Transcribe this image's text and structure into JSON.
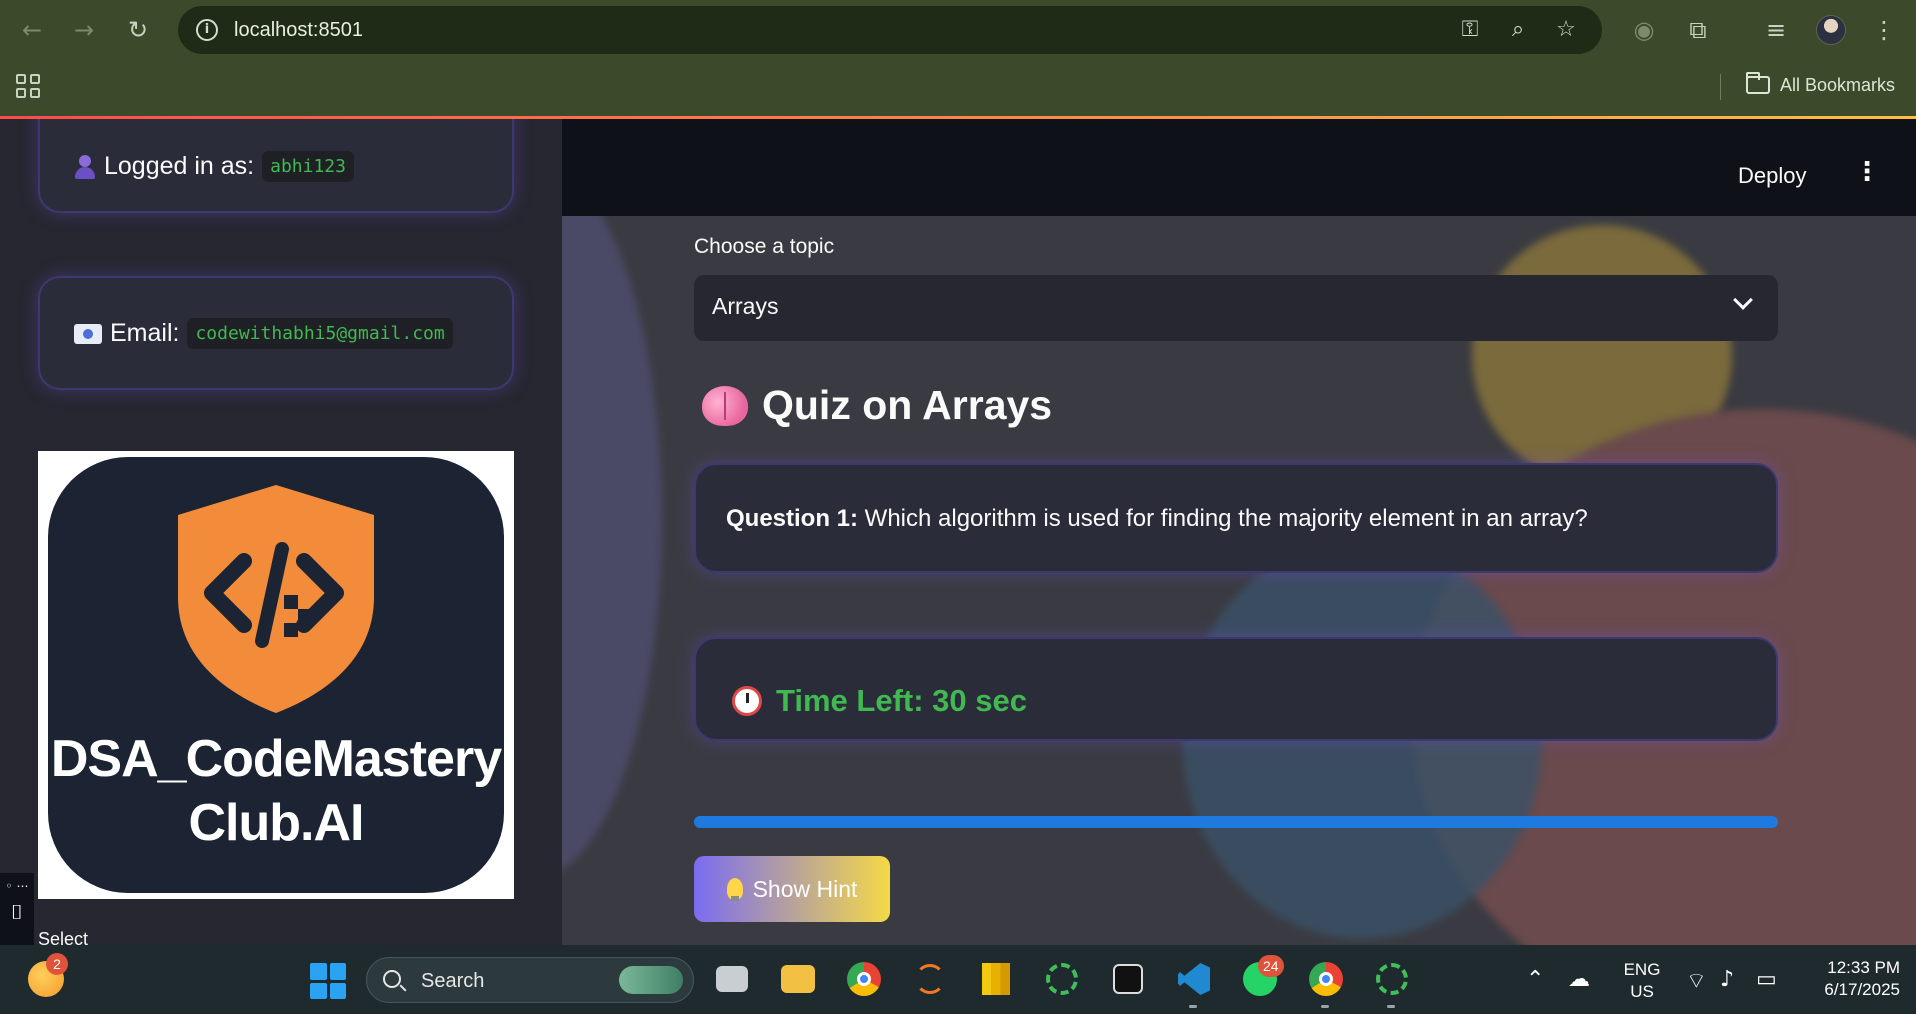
{
  "browser": {
    "url": "localhost:8501",
    "bookmarks_label": "All Bookmarks",
    "icons": [
      "back-icon",
      "forward-icon",
      "reload-icon",
      "site-info-icon",
      "password-key-icon",
      "zoom-icon",
      "star-icon",
      "extension-icon",
      "puzzle-icon",
      "media-control-icon",
      "profile-avatar",
      "menu-icon",
      "apps-grid-icon",
      "folder-icon"
    ]
  },
  "sidebar": {
    "logged_in_label": "Logged in as:",
    "username": "abhi123",
    "email_label": "Email:",
    "email": "codewithabhi5@gmail.com",
    "logo_line1": "DSA_CodeMastery",
    "logo_line2": "Club.AI",
    "select_label": "Select"
  },
  "header": {
    "deploy_label": "Deploy"
  },
  "main": {
    "topic_label": "Choose a topic",
    "topic_value": "Arrays",
    "quiz_title": "Quiz on Arrays",
    "question_prefix": "Question 1:",
    "question_text": " Which algorithm is used for finding the majority element in an array?",
    "timer_text": "Time Left: 30 sec",
    "timer_progress": 1.0,
    "hint_button": "Show Hint"
  },
  "colors": {
    "accent_green": "#3fb950",
    "progress_blue": "#1f7ae0",
    "card_border": "#3c3970",
    "hint_gradient_start": "#7b6cf0",
    "hint_gradient_end": "#f4d946"
  },
  "taskbar": {
    "weather_badge": "2",
    "search_placeholder": "Search",
    "whatsapp_badge": "24",
    "lang_line1": "ENG",
    "lang_line2": "US",
    "time": "12:33 PM",
    "date": "6/17/2025"
  }
}
